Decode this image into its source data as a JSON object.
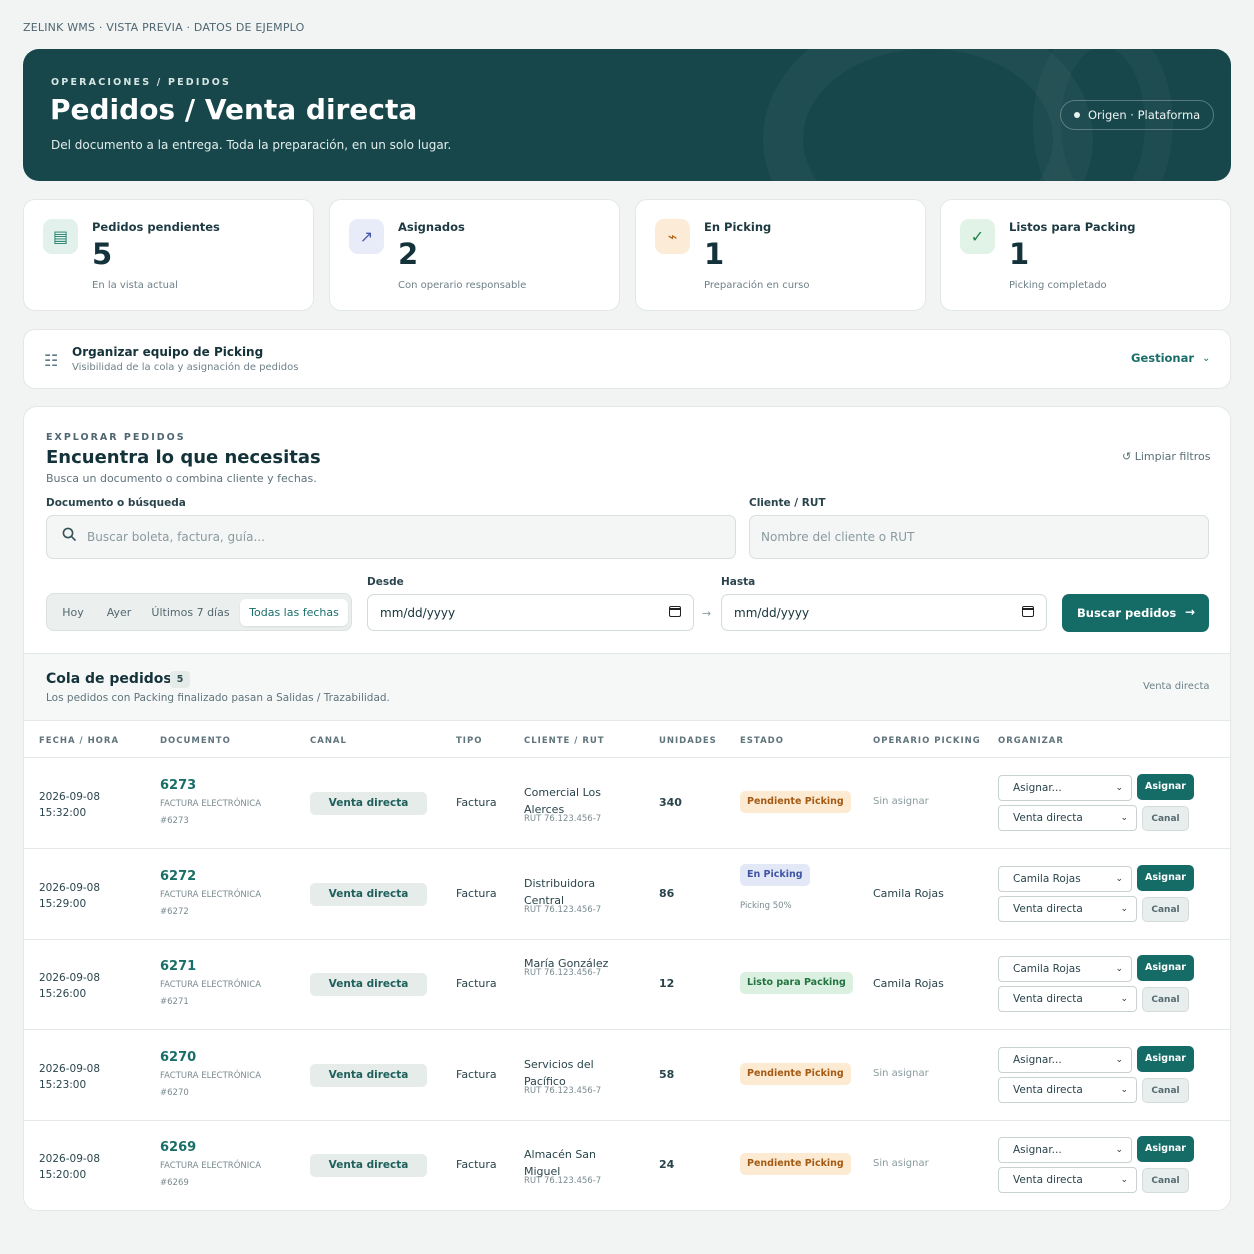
{
  "topline": "ZELINK WMS · VISTA PREVIA · DATOS DE EJEMPLO",
  "hero": {
    "kicker": "OPERACIONES / PEDIDOS",
    "title": "Pedidos / Venta directa",
    "subtitle": "Del documento a la entrega. Toda la preparación, en un solo lugar.",
    "origin": "Origen · Plataforma"
  },
  "stats": [
    {
      "label": "Pedidos pendientes",
      "value": "5",
      "sub": "En la vista actual",
      "icon": "list-icon",
      "glyph": "▤",
      "bg": "#e2f1ec",
      "color": "#1e7c68"
    },
    {
      "label": "Asignados",
      "value": "2",
      "sub": "Con operario responsable",
      "icon": "arrow-up-right-icon",
      "glyph": "↗",
      "bg": "#e8ebf8",
      "color": "#4557a8"
    },
    {
      "label": "En Picking",
      "value": "1",
      "sub": "Preparación en curso",
      "icon": "bolt-icon",
      "glyph": "⌁",
      "bg": "#fcecd7",
      "color": "#b1651b"
    },
    {
      "label": "Listos para Packing",
      "value": "1",
      "sub": "Picking completado",
      "icon": "check-icon",
      "glyph": "✓",
      "bg": "#e1f2e7",
      "color": "#238046"
    }
  ],
  "team": {
    "title": "Organizar equipo de Picking",
    "subtitle": "Visibilidad de la cola y asignación de pedidos",
    "manage": "Gestionar",
    "chevron": "⌄"
  },
  "explore": {
    "kicker": "EXPLORAR PEDIDOS",
    "title": "Encuentra lo que necesitas",
    "hint": "Busca un documento o combina cliente y fechas.",
    "clear": "↺ Limpiar filtros",
    "doc_label": "Documento o búsqueda",
    "doc_placeholder": "Buscar boleta, factura, guía...",
    "client_label": "Cliente / RUT",
    "client_placeholder": "Nombre del cliente o RUT",
    "ranges": [
      "Hoy",
      "Ayer",
      "Últimos 7 días",
      "Todas las fechas"
    ],
    "active_range": "Todas las fechas",
    "from_label": "Desde",
    "from_value": "mm/dd/yyyy",
    "to_label": "Hasta",
    "to_value": "mm/dd/yyyy",
    "arrow": "→",
    "search_button": "Buscar pedidos",
    "search_arrow": "→"
  },
  "queue": {
    "title": "Cola de pedidos",
    "count": "5",
    "subtitle": "Los pedidos con Packing finalizado pasan a Salidas / Trazabilidad.",
    "right": "Venta directa",
    "headers": [
      "FECHA / HORA",
      "DOCUMENTO",
      "CANAL",
      "TIPO",
      "CLIENTE / RUT",
      "UNIDADES",
      "ESTADO",
      "OPERARIO PICKING",
      "ORGANIZAR"
    ],
    "assign_label": "Asignar",
    "canal_label": "Canal",
    "rows": [
      {
        "date": "2026-09-08",
        "time": "15:32:00",
        "doc": "6273",
        "doc_type": "FACTURA ELECTRÓNICA",
        "doc_ref": "#6273",
        "channel": "Venta directa",
        "type": "Factura",
        "client": "Comercial Los Alerces",
        "client_lines": 2,
        "rut": "RUT 76.123.456-7",
        "units": "340",
        "status": "Pendiente Picking",
        "status_kind": "pend",
        "status_sub": "",
        "operator": "Sin asignar",
        "operator_assigned": false,
        "select_assign": "Asignar...",
        "select_channel": "Venta directa"
      },
      {
        "date": "2026-09-08",
        "time": "15:29:00",
        "doc": "6272",
        "doc_type": "FACTURA ELECTRÓNICA",
        "doc_ref": "#6272",
        "channel": "Venta directa",
        "type": "Factura",
        "client": "Distribuidora Central",
        "client_lines": 2,
        "rut": "RUT 76.123.456-7",
        "units": "86",
        "status": "En Picking",
        "status_kind": "pick",
        "status_sub": "Picking 50%",
        "operator": "Camila Rojas",
        "operator_assigned": true,
        "select_assign": "Camila Rojas",
        "select_channel": "Venta directa"
      },
      {
        "date": "2026-09-08",
        "time": "15:26:00",
        "doc": "6271",
        "doc_type": "FACTURA ELECTRÓNICA",
        "doc_ref": "#6271",
        "channel": "Venta directa",
        "type": "Factura",
        "client": "María González",
        "client_lines": 1,
        "rut": "RUT 76.123.456-7",
        "units": "12",
        "status": "Listo para Packing",
        "status_kind": "ready",
        "status_sub": "",
        "operator": "Camila Rojas",
        "operator_assigned": true,
        "select_assign": "Camila Rojas",
        "select_channel": "Venta directa"
      },
      {
        "date": "2026-09-08",
        "time": "15:23:00",
        "doc": "6270",
        "doc_type": "FACTURA ELECTRÓNICA",
        "doc_ref": "#6270",
        "channel": "Venta directa",
        "type": "Factura",
        "client": "Servicios del Pacífico",
        "client_lines": 2,
        "rut": "RUT 76.123.456-7",
        "units": "58",
        "status": "Pendiente Picking",
        "status_kind": "pend",
        "status_sub": "",
        "operator": "Sin asignar",
        "operator_assigned": false,
        "select_assign": "Asignar...",
        "select_channel": "Venta directa"
      },
      {
        "date": "2026-09-08",
        "time": "15:20:00",
        "doc": "6269",
        "doc_type": "FACTURA ELECTRÓNICA",
        "doc_ref": "#6269",
        "channel": "Venta directa",
        "type": "Factura",
        "client": "Almacén San Miguel",
        "client_lines": 2,
        "rut": "RUT 76.123.456-7",
        "units": "24",
        "status": "Pendiente Picking",
        "status_kind": "pend",
        "status_sub": "",
        "operator": "Sin asignar",
        "operator_assigned": false,
        "select_assign": "Asignar...",
        "select_channel": "Venta directa"
      }
    ]
  }
}
